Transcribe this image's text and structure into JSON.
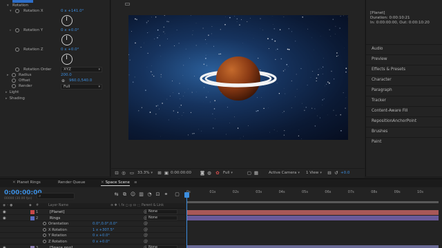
{
  "effect_controls": {
    "rows": [
      {
        "label": "Rotation",
        "value": ""
      },
      {
        "label": "Rotation X",
        "value": "0 x +141.0°"
      },
      {
        "label": "Rotation Y",
        "value": "0 x +0.0°"
      },
      {
        "label": "Rotation Z",
        "value": "0 x +0.0°"
      },
      {
        "label": "Rotation Order",
        "value": "XYZ"
      },
      {
        "label": "Radius",
        "value": "200.0"
      },
      {
        "label": "Offset",
        "value": "960.0,540.0"
      },
      {
        "label": "Render",
        "value": "Full"
      },
      {
        "label": "Light",
        "value": ""
      },
      {
        "label": "Shading",
        "value": ""
      }
    ]
  },
  "viewer": {
    "zoom": "33.3%",
    "resolution": "Full",
    "camera": "Active Camera",
    "view": "1 View"
  },
  "info_panel": {
    "layer": "[Planet]",
    "duration": "Duration: 0:00:10:21",
    "in_out": "In: 0:00:00:00, Out: 0:00:10:20"
  },
  "right_panels": [
    "Audio",
    "Preview",
    "Effects & Presets",
    "Character",
    "Paragraph",
    "Tracker",
    "Content-Aware Fill",
    "RepositionAnchorPoint",
    "Brushes",
    "Paint"
  ],
  "tabs": [
    {
      "label": "Planet Rings",
      "active": false
    },
    {
      "label": "Render Queue",
      "active": false
    },
    {
      "label": "Space Scene",
      "active": true
    }
  ],
  "timeline": {
    "timecode": "0:00:00:00",
    "fps": "00000 (30.00 fps)",
    "header": {
      "layer_name": "Layer Name",
      "parent": "Parent & Link"
    },
    "ticks": [
      "0s",
      "01s",
      "02s",
      "03s",
      "04s",
      "05s",
      "06s",
      "07s",
      "08s",
      "09s",
      "10s"
    ],
    "layers": [
      {
        "num": "1",
        "name": "[Planet]",
        "parent": "None",
        "color": "#c94848",
        "bar": "#a85858"
      },
      {
        "num": "2",
        "name": "Rings",
        "parent": "None",
        "color": "#5a6bc0",
        "bar": "#6a5a9a"
      },
      {
        "prop": "Orientation",
        "value": "0.0°,0.0°,0.0°"
      },
      {
        "prop": "X Rotation",
        "value": "1 x +307.5°"
      },
      {
        "prop": "Y Rotation",
        "value": "0 x +0.0°"
      },
      {
        "prop": "Z Rotation",
        "value": "0 x +0.0°"
      },
      {
        "num": "3",
        "name": "[Space.png]",
        "parent": "None",
        "color": "#8a7ab0",
        "bar": "#6a6a96"
      }
    ]
  },
  "colors": {
    "accent": "#3c8ee0",
    "planet": "#8a3a14",
    "space": "#16335e"
  }
}
